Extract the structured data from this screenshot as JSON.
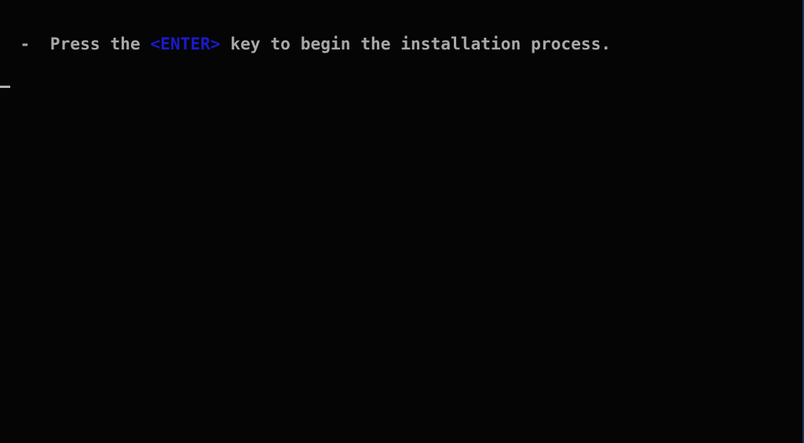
{
  "console": {
    "prefix": "  -  ",
    "text_before_key": "Press the ",
    "key_label": "<ENTER>",
    "text_after_key": " key to begin the installation process.",
    "text_color": "#a8a8a8",
    "key_color": "#1a1acc",
    "background_color": "#050505"
  },
  "cursor": {
    "glyph": "_"
  }
}
